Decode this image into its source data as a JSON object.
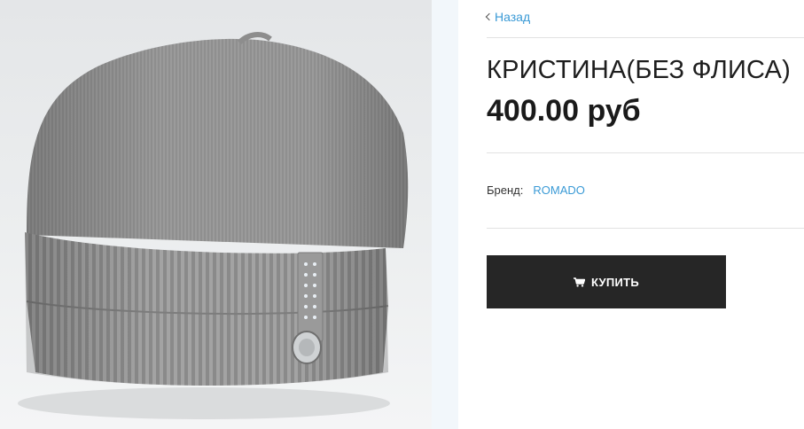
{
  "product_image": {
    "alt": "Шапка КРИСТИНА (без флиса)"
  },
  "nav": {
    "back_label": "Назад",
    "back_icon": "chevron-left-icon"
  },
  "product": {
    "title": "КРИСТИНА(БЕЗ ФЛИСА)",
    "price": "400.00 руб",
    "brand_label": "Бренд:",
    "brand_value": "ROMADO"
  },
  "actions": {
    "buy_label": "КУПИТЬ",
    "buy_icon": "cart-icon"
  },
  "colors": {
    "accent": "#3a9ad6",
    "button_bg": "#262626",
    "button_text": "#ffffff",
    "text": "#1e1e1e",
    "divider": "#e2e2e2"
  }
}
